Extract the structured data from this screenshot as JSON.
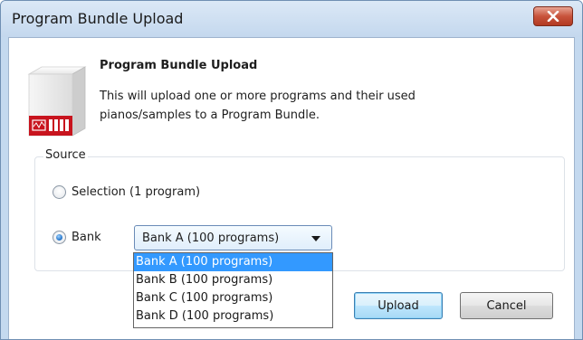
{
  "window": {
    "title": "Program Bundle Upload",
    "close_icon": "close-icon"
  },
  "header": {
    "title": "Program Bundle Upload",
    "description": "This will upload one or more programs and their used pianos/samples to a Program Bundle.",
    "icon": "program-bundle-icon",
    "colors": {
      "icon_red": "#c8141e",
      "icon_white": "#f4f4f4"
    }
  },
  "source": {
    "label": "Source",
    "options": [
      {
        "label": "Selection (1 program)",
        "checked": false
      },
      {
        "label": "Bank",
        "checked": true
      }
    ],
    "bank_select": {
      "value": "Bank A (100 programs)",
      "dropdown_open": true,
      "options": [
        "Bank A (100 programs)",
        "Bank B (100 programs)",
        "Bank C (100 programs)",
        "Bank D (100 programs)"
      ],
      "highlighted_index": 0
    }
  },
  "buttons": {
    "upload": "Upload",
    "cancel": "Cancel"
  },
  "colors": {
    "highlight": "#3399ff",
    "close_button": "#c8533c",
    "title_bar": "#c4d8ee"
  }
}
